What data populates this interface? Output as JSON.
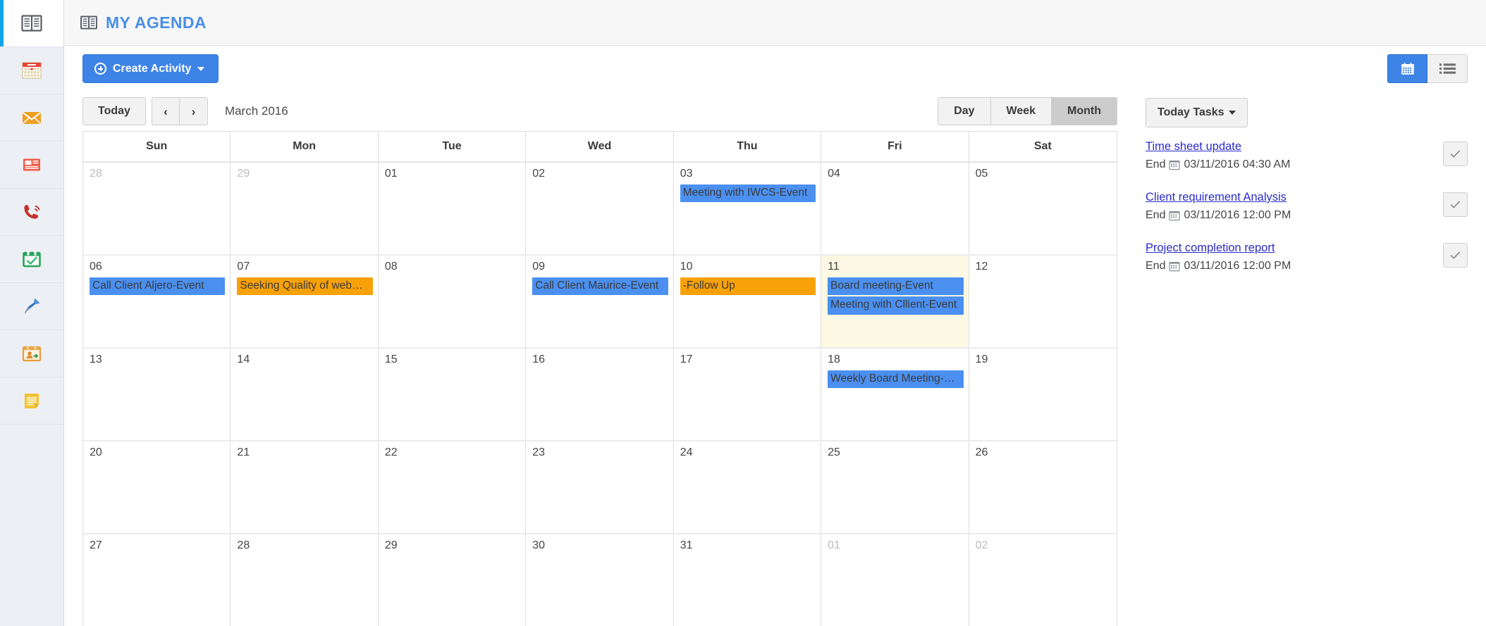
{
  "accent": {
    "brand_blue": "#4a8fe8",
    "button_blue": "#3d84e6",
    "event_blue": "#4b90f0",
    "event_orange": "#f9a108",
    "today_cell": "#fdf8e3",
    "rail_active_bar": "#12a3e8",
    "link_blue": "#2b2bc9"
  },
  "rail": {
    "items": [
      {
        "icon": "agenda-book-icon",
        "active": true
      },
      {
        "icon": "calendar-icon",
        "active": false
      },
      {
        "icon": "envelope-icon",
        "active": false
      },
      {
        "icon": "news-list-icon",
        "active": false
      },
      {
        "icon": "phone-call-icon",
        "active": false
      },
      {
        "icon": "calendar-check-icon",
        "active": false
      },
      {
        "icon": "pushpin-icon",
        "active": false
      },
      {
        "icon": "calendar-contact-icon",
        "active": false
      },
      {
        "icon": "note-icon",
        "active": false
      }
    ]
  },
  "header": {
    "icon": "agenda-book-icon",
    "title": "MY AGENDA"
  },
  "toolbar": {
    "create_label": "Create Activity",
    "view_toggle": [
      {
        "name": "calendar-view",
        "icon": "calendar-icon",
        "active": true
      },
      {
        "name": "list-view",
        "icon": "list-icon",
        "active": false
      }
    ]
  },
  "calendar_nav": {
    "today_label": "Today",
    "prev_label": "‹",
    "next_label": "›",
    "period_label": "March 2016",
    "range_buttons": [
      {
        "label": "Day",
        "active": false
      },
      {
        "label": "Week",
        "active": false
      },
      {
        "label": "Month",
        "active": true
      }
    ]
  },
  "calendar": {
    "day_headers": [
      "Sun",
      "Mon",
      "Tue",
      "Wed",
      "Thu",
      "Fri",
      "Sat"
    ],
    "weeks": [
      [
        {
          "day": "28",
          "other_month": true,
          "today": false,
          "events": []
        },
        {
          "day": "29",
          "other_month": true,
          "today": false,
          "events": []
        },
        {
          "day": "01",
          "other_month": false,
          "today": false,
          "events": []
        },
        {
          "day": "02",
          "other_month": false,
          "today": false,
          "events": []
        },
        {
          "day": "03",
          "other_month": false,
          "today": false,
          "events": [
            {
              "title": "Meeting with IWCS-Event",
              "color": "blue"
            }
          ]
        },
        {
          "day": "04",
          "other_month": false,
          "today": false,
          "events": []
        },
        {
          "day": "05",
          "other_month": false,
          "today": false,
          "events": []
        }
      ],
      [
        {
          "day": "06",
          "other_month": false,
          "today": false,
          "events": [
            {
              "title": "Call Client Aljero-Event",
              "color": "blue"
            }
          ]
        },
        {
          "day": "07",
          "other_month": false,
          "today": false,
          "events": [
            {
              "title": "Seeking Quality of web…",
              "color": "orange"
            }
          ]
        },
        {
          "day": "08",
          "other_month": false,
          "today": false,
          "events": []
        },
        {
          "day": "09",
          "other_month": false,
          "today": false,
          "events": [
            {
              "title": "Call Client Maurice-Event",
              "color": "blue"
            }
          ]
        },
        {
          "day": "10",
          "other_month": false,
          "today": false,
          "events": [
            {
              "title": "-Follow Up",
              "color": "orange"
            }
          ]
        },
        {
          "day": "11",
          "other_month": false,
          "today": true,
          "events": [
            {
              "title": "Board meeting-Event",
              "color": "blue"
            },
            {
              "title": "Meeting with Cllient-Event",
              "color": "blue"
            }
          ]
        },
        {
          "day": "12",
          "other_month": false,
          "today": false,
          "events": []
        }
      ],
      [
        {
          "day": "13",
          "other_month": false,
          "today": false,
          "events": []
        },
        {
          "day": "14",
          "other_month": false,
          "today": false,
          "events": []
        },
        {
          "day": "15",
          "other_month": false,
          "today": false,
          "events": []
        },
        {
          "day": "16",
          "other_month": false,
          "today": false,
          "events": []
        },
        {
          "day": "17",
          "other_month": false,
          "today": false,
          "events": []
        },
        {
          "day": "18",
          "other_month": false,
          "today": false,
          "events": [
            {
              "title": "Weekly Board Meeting-…",
              "color": "blue"
            }
          ]
        },
        {
          "day": "19",
          "other_month": false,
          "today": false,
          "events": []
        }
      ],
      [
        {
          "day": "20",
          "other_month": false,
          "today": false,
          "events": []
        },
        {
          "day": "21",
          "other_month": false,
          "today": false,
          "events": []
        },
        {
          "day": "22",
          "other_month": false,
          "today": false,
          "events": []
        },
        {
          "day": "23",
          "other_month": false,
          "today": false,
          "events": []
        },
        {
          "day": "24",
          "other_month": false,
          "today": false,
          "events": []
        },
        {
          "day": "25",
          "other_month": false,
          "today": false,
          "events": []
        },
        {
          "day": "26",
          "other_month": false,
          "today": false,
          "events": []
        }
      ],
      [
        {
          "day": "27",
          "other_month": false,
          "today": false,
          "events": []
        },
        {
          "day": "28",
          "other_month": false,
          "today": false,
          "events": []
        },
        {
          "day": "29",
          "other_month": false,
          "today": false,
          "events": []
        },
        {
          "day": "30",
          "other_month": false,
          "today": false,
          "events": []
        },
        {
          "day": "31",
          "other_month": false,
          "today": false,
          "events": []
        },
        {
          "day": "01",
          "other_month": true,
          "today": false,
          "events": []
        },
        {
          "day": "02",
          "other_month": true,
          "today": false,
          "events": []
        }
      ]
    ]
  },
  "tasks_panel": {
    "dropdown_label": "Today Tasks",
    "end_prefix": "End",
    "tasks": [
      {
        "title": "Time sheet update",
        "end": "03/11/2016 04:30 AM",
        "done": false
      },
      {
        "title": "Client requirement Analysis",
        "end": "03/11/2016 12:00 PM",
        "done": false
      },
      {
        "title": "Project completion report",
        "end": "03/11/2016 12:00 PM",
        "done": false
      }
    ]
  }
}
